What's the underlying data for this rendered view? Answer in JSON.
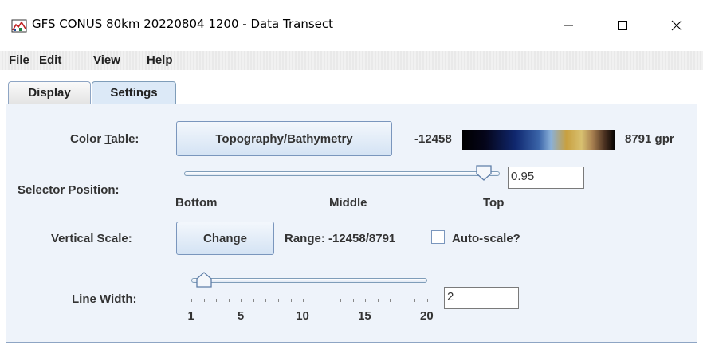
{
  "window": {
    "title": "GFS CONUS 80km 20220804 1200 - Data Transect",
    "icons": {
      "app": "app-icon",
      "minimize": "minimize-icon",
      "maximize": "maximize-icon",
      "close": "close-icon"
    }
  },
  "menu": [
    {
      "mnemonic": "F",
      "rest": "ile"
    },
    {
      "mnemonic": "E",
      "rest": "dit"
    },
    {
      "mnemonic": "V",
      "rest": "iew"
    },
    {
      "mnemonic": "H",
      "rest": "elp"
    }
  ],
  "tabs": [
    {
      "label": "Display",
      "selected": false
    },
    {
      "label": "Settings",
      "selected": true
    }
  ],
  "settings": {
    "color_table_label_pre": "Color ",
    "color_table_label_mn": "T",
    "color_table_label_post": "able:",
    "color_table_button": "Topography/Bathymetry",
    "range_min": "-12458",
    "range_max": "8791 gpr",
    "selector_label": "Selector Position:",
    "selector_value": "0.95",
    "selector_fraction": 0.95,
    "selector_ticks": {
      "bottom": "Bottom",
      "middle": "Middle",
      "top": "Top"
    },
    "vertical_scale_label": "Vertical Scale:",
    "change_button": "Change",
    "range_text": "Range: -12458/8791",
    "autoscale_label": "Auto-scale?",
    "autoscale_checked": false,
    "line_width_label": "Line Width:",
    "line_width_value": "2",
    "line_width_min": 1,
    "line_width_max": 20,
    "line_width_current": 2,
    "line_width_ticks": [
      "1",
      "5",
      "10",
      "15",
      "20"
    ]
  }
}
